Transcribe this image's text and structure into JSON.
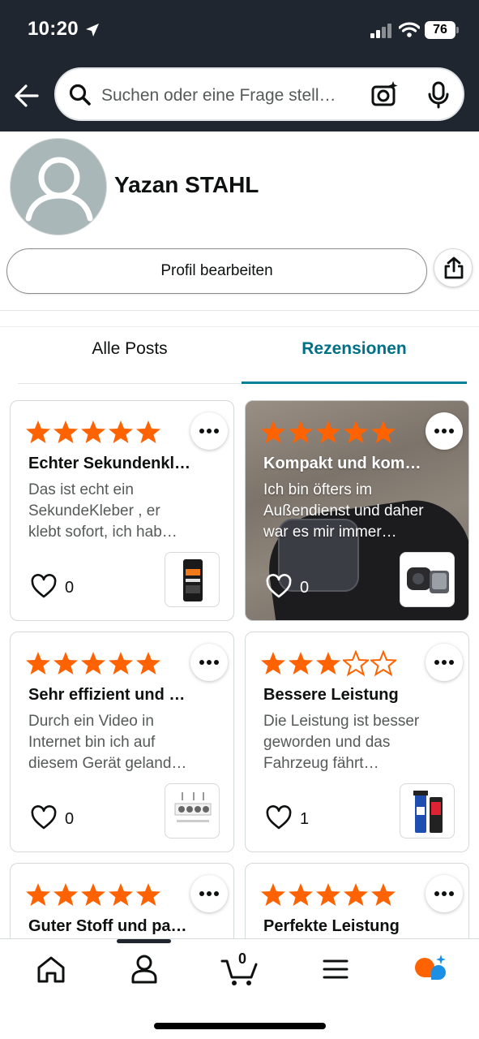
{
  "status_bar": {
    "time": "10:20",
    "battery": "76"
  },
  "search": {
    "placeholder": "Suchen oder eine Frage stell…"
  },
  "profile": {
    "name": "Yazan STAHL",
    "edit_label": "Profil bearbeiten"
  },
  "tabs": [
    {
      "label": "Alle Posts",
      "active": false
    },
    {
      "label": "Rezensionen",
      "active": true
    }
  ],
  "reviews": [
    {
      "rating": 5,
      "title": "Echter Sekundenkl…",
      "text": [
        "Das ist echt ein",
        "SekundeKleber , er",
        "klebt sofort, ich hab…"
      ],
      "likes": "0",
      "has_photo": false
    },
    {
      "rating": 5,
      "title": "Kompakt und kom…",
      "text": [
        "Ich bin öfters im",
        "Außendienst und daher",
        "war es mir immer…"
      ],
      "likes": "0",
      "has_photo": true
    },
    {
      "rating": 5,
      "title": "Sehr effizient und …",
      "text": [
        "Durch ein Video in",
        "Internet bin ich auf",
        "diesem Gerät geland…"
      ],
      "likes": "0",
      "has_photo": false
    },
    {
      "rating": 3,
      "title": "Bessere Leistung",
      "text": [
        "Die Leistung ist besser",
        "geworden und das",
        "Fahrzeug fährt…"
      ],
      "likes": "1",
      "has_photo": false
    },
    {
      "rating": 5,
      "title": "Guter Stoff und pa…",
      "text": [],
      "likes": "",
      "has_photo": false
    },
    {
      "rating": 5,
      "title": "Perfekte Leistung",
      "text": [],
      "likes": "",
      "has_photo": false
    }
  ],
  "bottom_nav": {
    "items": [
      "home-icon",
      "account-icon",
      "cart-icon",
      "menu-icon",
      "rufus-icon"
    ],
    "cart_count": "0"
  },
  "colors": {
    "header_bg": "#1f2630",
    "star": "#ff6200",
    "accent": "#007185",
    "rufus_orange": "#ff6200",
    "rufus_blue": "#1a8fe3"
  }
}
